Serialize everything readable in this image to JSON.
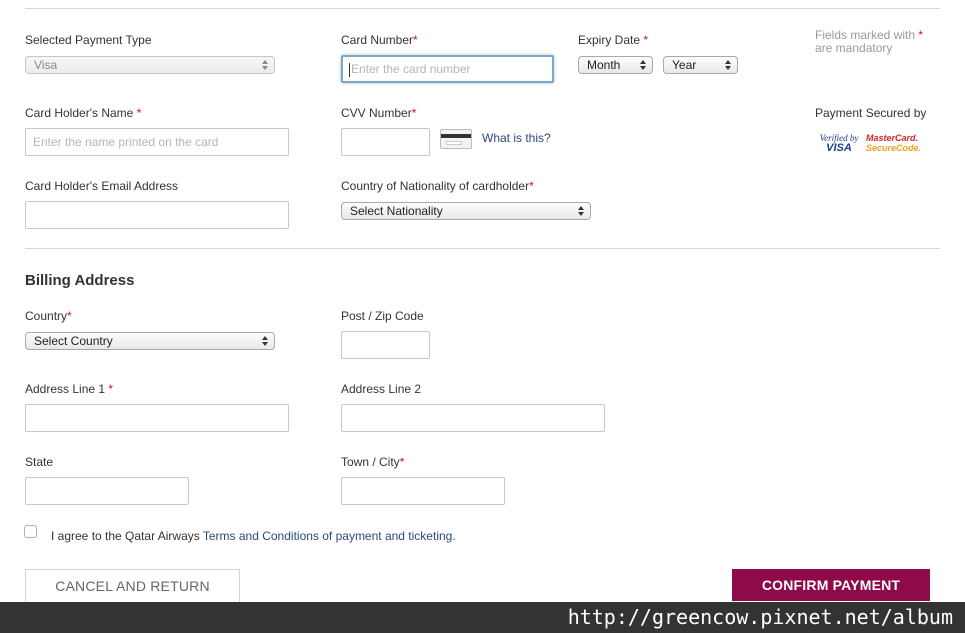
{
  "payment": {
    "payment_type": {
      "label": "Selected Payment Type",
      "value": "Visa"
    },
    "card_number": {
      "label": "Card Number",
      "required": "*",
      "placeholder": "Enter the card number"
    },
    "expiry": {
      "label": "Expiry Date ",
      "required": "*",
      "month": "Month",
      "year": "Year"
    },
    "mandatory_note": {
      "line1": "Fields marked with ",
      "star": "*",
      "line2": "are mandatory"
    },
    "holder_name": {
      "label": "Card Holder's Name ",
      "required": "*",
      "placeholder": "Enter the name printed on the card"
    },
    "cvv": {
      "label": "CVV Number",
      "required": "*",
      "help_link": "What is this?"
    },
    "secured": {
      "label": "Payment Secured by",
      "visa_line1": "Verified by",
      "visa_line2": "VISA",
      "mc_line1": "MasterCard.",
      "mc_line2": "SecureCode."
    },
    "email": {
      "label": "Card Holder's Email Address"
    },
    "nationality": {
      "label": "Country of Nationality of cardholder",
      "required": "*",
      "value": "Select Nationality"
    }
  },
  "billing": {
    "title": "Billing Address",
    "country": {
      "label": "Country",
      "required": "*",
      "value": "Select Country"
    },
    "zip": {
      "label": "Post / Zip Code"
    },
    "address1": {
      "label": "Address Line 1 ",
      "required": "*"
    },
    "address2": {
      "label": "Address Line 2"
    },
    "state": {
      "label": "State"
    },
    "city": {
      "label": "Town / City",
      "required": "*"
    }
  },
  "agreement": {
    "prefix": "I agree to the Qatar Airways ",
    "link": "Terms and Conditions of payment and ticketing."
  },
  "actions": {
    "cancel": "CANCEL AND RETURN",
    "confirm": "CONFIRM PAYMENT"
  },
  "watermark": "http://greencow.pixnet.net/album",
  "colors": {
    "confirm_button": "#8e0a4a",
    "required_star": "#c8102e",
    "link": "#2a4a7f",
    "focus_border": "#7fa7c4"
  }
}
